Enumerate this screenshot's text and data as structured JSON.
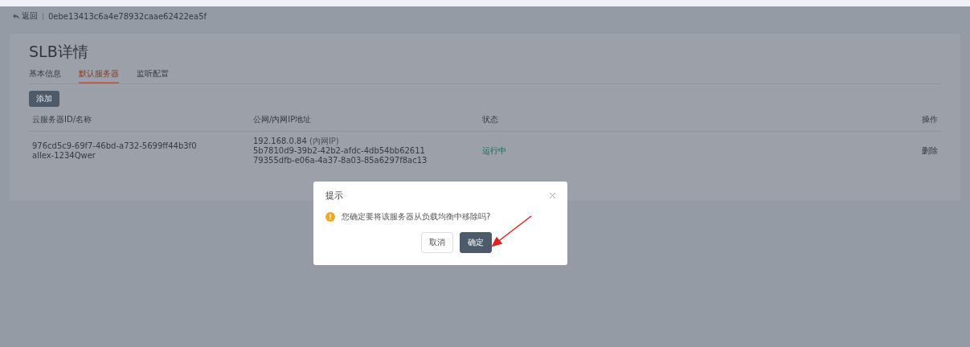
{
  "breadcrumb": {
    "back": "返回",
    "id": "0ebe13413c6a4e78932caae62422ea5f"
  },
  "title": "SLB详情",
  "tabs": [
    {
      "label": "基本信息",
      "selected": false
    },
    {
      "label": "默认服务器",
      "selected": true
    },
    {
      "label": "监听配置",
      "selected": false
    }
  ],
  "add_button": "添加",
  "table": {
    "columns": [
      "云服务器ID/名称",
      "公网/内网IP地址",
      "状态",
      "操作"
    ],
    "rows": [
      {
        "id": "976cd5c9-69f7-46bd-a732-5699ff44b3f0",
        "name": "allex-1234Qwer",
        "ip": "192.168.0.84",
        "ip_note": "(内网IP)",
        "ids": [
          "5b7810d9-39b2-42b2-afdc-4db54bb62611",
          "79355dfb-e06a-4a37-8a03-85a6297f8ac13"
        ],
        "status": "运行中",
        "action": "删除"
      }
    ]
  },
  "dialog": {
    "title": "提示",
    "message": "您确定要将该服务器从负载均衡中移除吗?",
    "buttons": [
      {
        "label": "取消",
        "kind": "default"
      },
      {
        "label": "确定",
        "kind": "primary"
      }
    ]
  }
}
